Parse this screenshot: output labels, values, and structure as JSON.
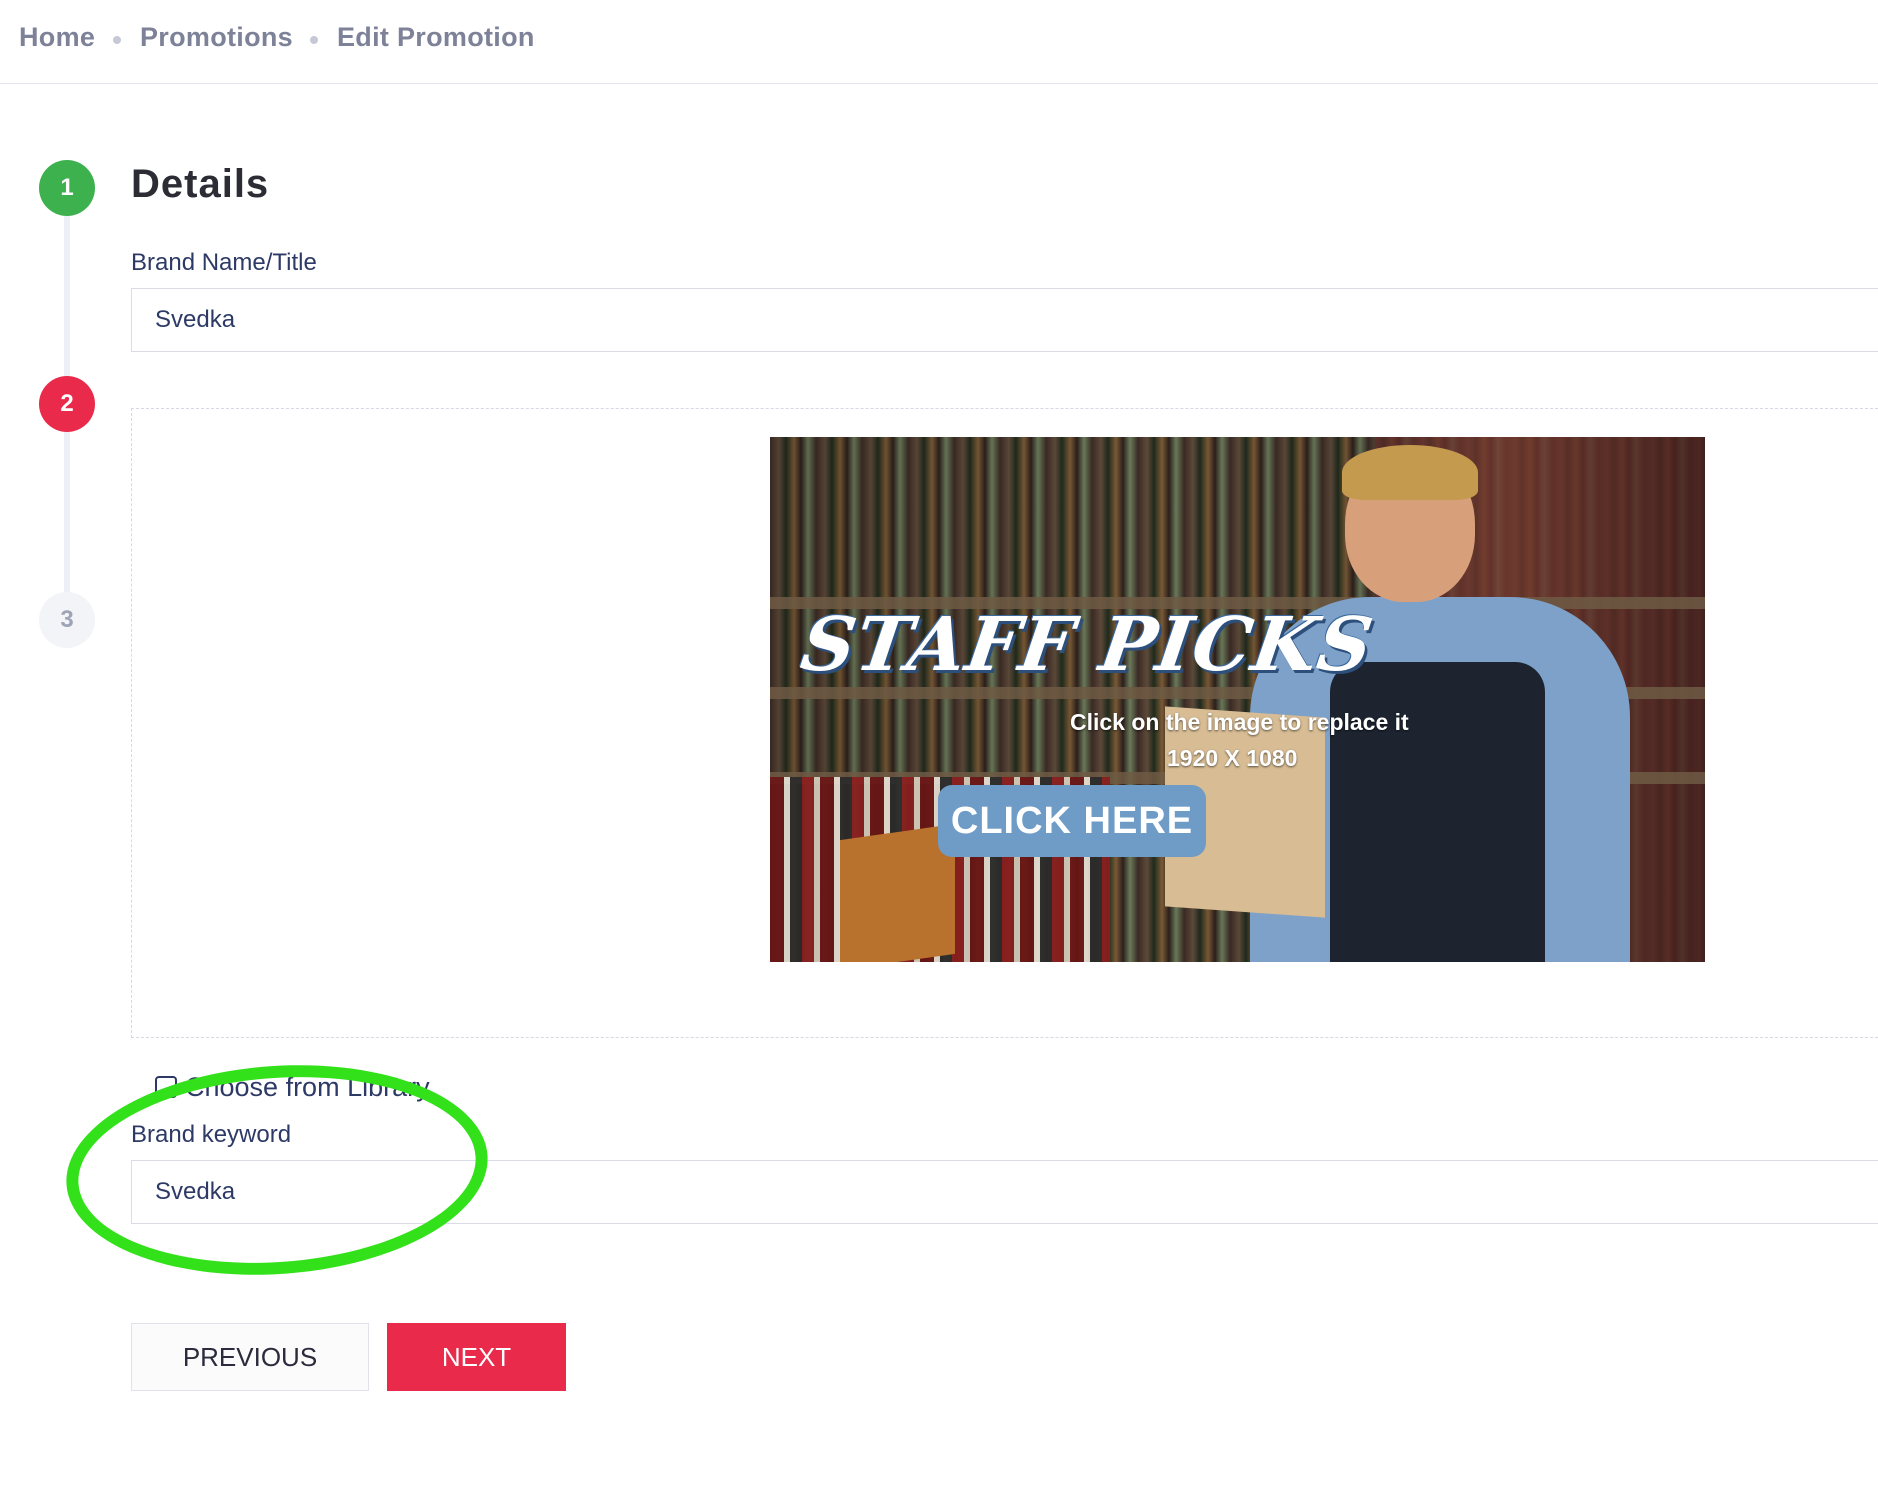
{
  "breadcrumb": {
    "items": [
      "Home",
      "Promotions",
      "Edit Promotion"
    ]
  },
  "stepper": {
    "steps": [
      {
        "number": "1",
        "state": "complete",
        "color": "#3cb14e"
      },
      {
        "number": "2",
        "state": "error",
        "color": "#ea2a4a"
      },
      {
        "number": "3",
        "state": "pending",
        "color": "#f3f4f8"
      }
    ]
  },
  "details": {
    "title": "Details",
    "brand_name_label": "Brand Name/Title",
    "brand_name_value": "Svedka"
  },
  "image_upload": {
    "headline": "STAFF PICKS",
    "hint": "Click on the image to replace it",
    "dimensions": "1920 X 1080",
    "cta": "CLICK HERE"
  },
  "library": {
    "label": "Choose from Library",
    "checked": false
  },
  "keyword": {
    "label": "Brand keyword",
    "value": "Svedka"
  },
  "actions": {
    "previous_label": "PREVIOUS",
    "next_label": "NEXT"
  },
  "colors": {
    "accent": "#ea2a4a",
    "success": "#3cb14e",
    "annotation": "#33e11a",
    "cta": "#6f9cc6"
  }
}
